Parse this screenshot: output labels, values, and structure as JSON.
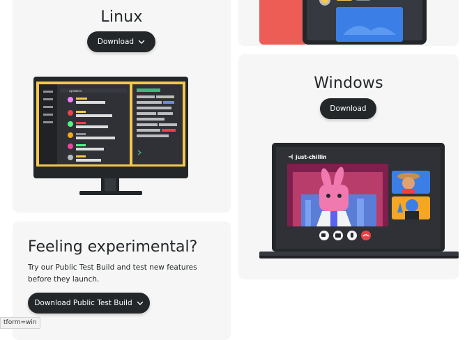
{
  "linux": {
    "title": "Linux",
    "download_label": "Download",
    "channel_name": "updates"
  },
  "windows": {
    "title": "Windows",
    "download_label": "Download",
    "channel_name": "just-chillin"
  },
  "experimental": {
    "title": "Feeling experimental?",
    "description": "Try our Public Test Build and test new features before they launch.",
    "download_label": "Download Public Test Build"
  },
  "status_bar": {
    "text": "tform=win"
  },
  "colors": {
    "button_bg": "#23272a",
    "card_bg": "#f6f6f6",
    "accent_yellow": "#f5c84c",
    "accent_red": "#ed4245",
    "blurple": "#5865f2"
  },
  "icons": {
    "download_chevron": "chevron-down-icon",
    "voice": "speaker-icon",
    "call_controls": [
      "camera-icon",
      "screen-share-icon",
      "mic-icon",
      "hangup-icon"
    ]
  }
}
